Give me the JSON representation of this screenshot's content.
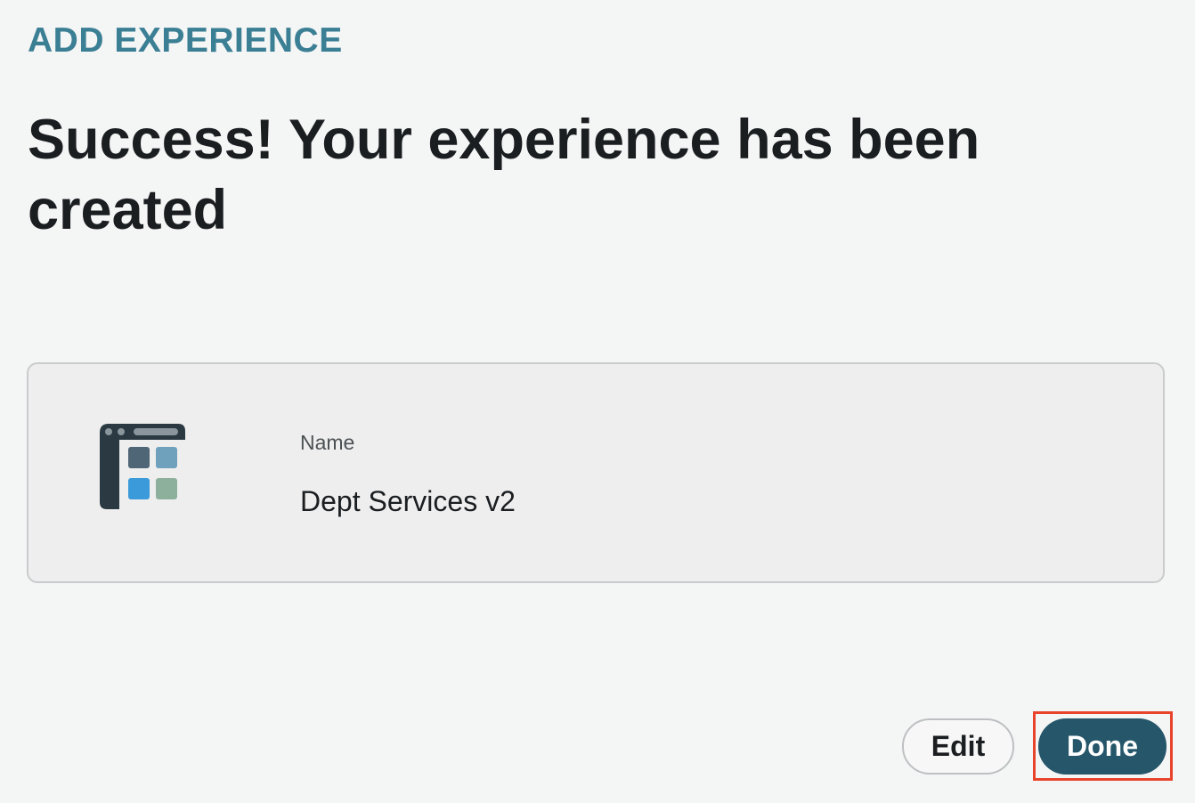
{
  "header": {
    "eyebrow": "ADD EXPERIENCE",
    "title": "Success! Your experience has been created"
  },
  "experience_card": {
    "icon": "experience-grid-icon",
    "name_label": "Name",
    "name_value": "Dept Services v2"
  },
  "actions": {
    "edit_label": "Edit",
    "done_label": "Done"
  },
  "colors": {
    "accent": "#3b7f95",
    "primary_button": "#25566a",
    "highlight_outline": "#e8442c",
    "background": "#f4f5f5"
  }
}
